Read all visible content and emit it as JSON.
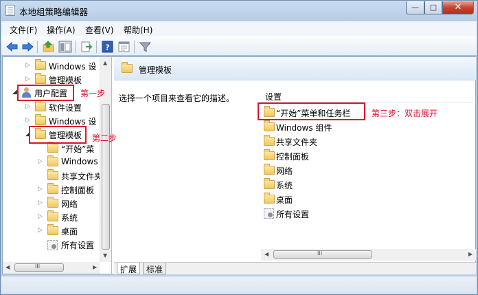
{
  "window": {
    "title": "本地组策略编辑器",
    "btn_min": "—",
    "btn_max": "□",
    "btn_close": "✕"
  },
  "menu": [
    "文件(F)",
    "操作(A)",
    "查看(V)",
    "帮助(H)"
  ],
  "toolbar": [
    "back-icon",
    "forward-icon",
    "up-icon",
    "show-hide-tree-icon",
    "export-list-icon",
    "help-icon",
    "properties-icon",
    "filter-icon"
  ],
  "tree": {
    "items": [
      {
        "label": "Windows 设"
      },
      {
        "label": "管理模板"
      },
      {
        "label": "用户配置"
      },
      {
        "label": "软件设置"
      },
      {
        "label": "Windows 设"
      },
      {
        "label": "管理模板"
      },
      {
        "label": "“开始”菜"
      },
      {
        "label": "Windows"
      },
      {
        "label": "共享文件夹"
      },
      {
        "label": "控制面板"
      },
      {
        "label": "网络"
      },
      {
        "label": "系统"
      },
      {
        "label": "桌面"
      },
      {
        "label": "所有设置"
      }
    ]
  },
  "pane": {
    "title": "管理模板",
    "description": "选择一个项目来查看它的描述。",
    "column": "设置",
    "items": [
      {
        "label": "“开始”菜单和任务栏"
      },
      {
        "label": "Windows 组件"
      },
      {
        "label": "共享文件夹"
      },
      {
        "label": "控制面板"
      },
      {
        "label": "网络"
      },
      {
        "label": "系统"
      },
      {
        "label": "桌面"
      },
      {
        "label": "所有设置"
      }
    ]
  },
  "tabs": [
    "扩展",
    "标准"
  ],
  "annotations": {
    "step1": "第一步",
    "step2": "第二步",
    "step3": "第三步：双击展开",
    "color": "#e0102a"
  },
  "scroll": {
    "arrow_up": "▲",
    "arrow_down": "▼",
    "arrow_left": "◀",
    "arrow_right": "▶",
    "grip": "III"
  }
}
